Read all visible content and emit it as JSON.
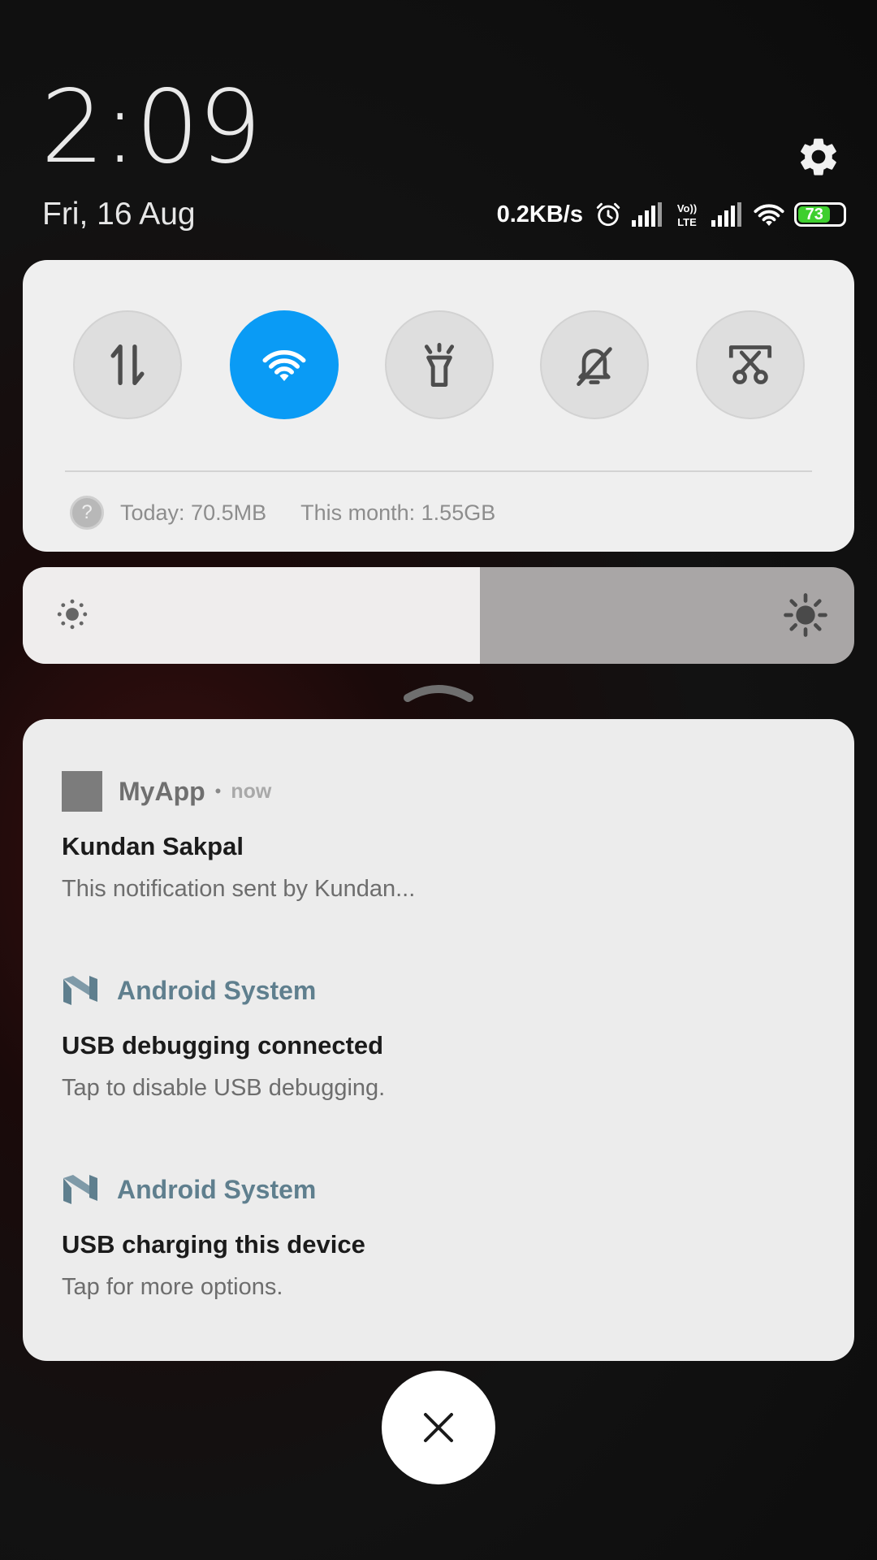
{
  "header": {
    "time": "2:09",
    "date": "Fri, 16 Aug"
  },
  "status_bar": {
    "net_speed": "0.2KB/s",
    "battery_level": "73",
    "icons": [
      "alarm-icon",
      "signal-icon",
      "volte-icon",
      "signal-icon",
      "wifi-icon",
      "battery-icon"
    ]
  },
  "quick_settings": {
    "toggles": [
      {
        "name": "mobile-data",
        "on": false
      },
      {
        "name": "wifi",
        "on": true
      },
      {
        "name": "flashlight",
        "on": false
      },
      {
        "name": "silent",
        "on": false
      },
      {
        "name": "screenshot",
        "on": false
      }
    ],
    "usage_today": "Today: 70.5MB",
    "usage_month": "This month: 1.55GB"
  },
  "brightness": {
    "level_fraction": 0.55
  },
  "notifications": [
    {
      "app": "MyApp",
      "time": "now",
      "title": "Kundan Sakpal",
      "text": "This notification sent by Kundan..."
    },
    {
      "app": "Android System",
      "title": "USB debugging connected",
      "text": "Tap to disable USB debugging."
    },
    {
      "app": "Android System",
      "title": "USB charging this device",
      "text": "Tap for more options."
    }
  ],
  "colors": {
    "accent": "#0a9bf5",
    "battery": "#3ecf2e",
    "system_app": "#5f7f8e"
  }
}
